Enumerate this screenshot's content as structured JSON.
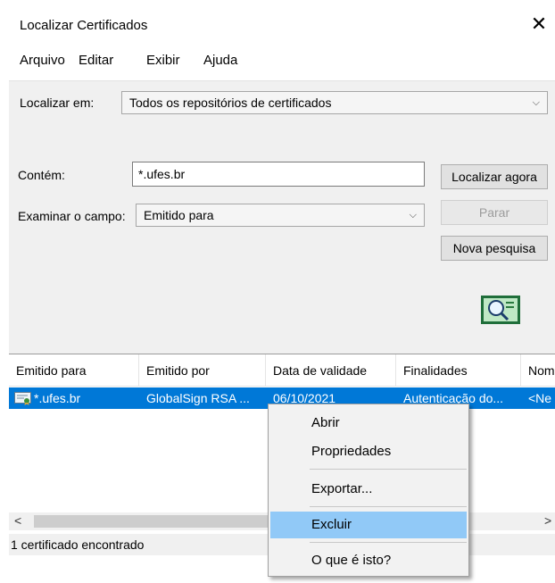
{
  "window": {
    "title": "Localizar Certificados",
    "close_glyph": "✕"
  },
  "menubar": [
    "Arquivo",
    "Editar",
    "Exibir",
    "Ajuda"
  ],
  "search": {
    "location_label": "Localizar em:",
    "location_value": "Todos os repositórios de certificados",
    "contains_label": "Contém:",
    "contains_value": "*.ufes.br",
    "field_label": "Examinar o campo:",
    "field_value": "Emitido para"
  },
  "buttons": {
    "find_now": "Localizar agora",
    "stop": "Parar",
    "new_search": "Nova pesquisa"
  },
  "list": {
    "columns": [
      "Emitido para",
      "Emitido por",
      "Data de validade",
      "Finalidades",
      "Nom"
    ],
    "rows": [
      [
        "*.ufes.br",
        "GlobalSign RSA ...",
        "06/10/2021",
        "Autenticação do...",
        "<Ne"
      ]
    ]
  },
  "status": {
    "text": "1 certificado encontrado"
  },
  "context_menu": {
    "items": [
      "Abrir",
      "Propriedades",
      "Exportar...",
      "Excluir",
      "O que é isto?"
    ],
    "highlighted": "Excluir"
  },
  "colors": {
    "selection": "#0078d7",
    "menu_highlight": "#91c9f7"
  },
  "icons": [
    "close-icon",
    "chevron-down-icon",
    "certificate-icon",
    "search-animation-icon",
    "scroll-left-icon",
    "scroll-right-icon"
  ]
}
